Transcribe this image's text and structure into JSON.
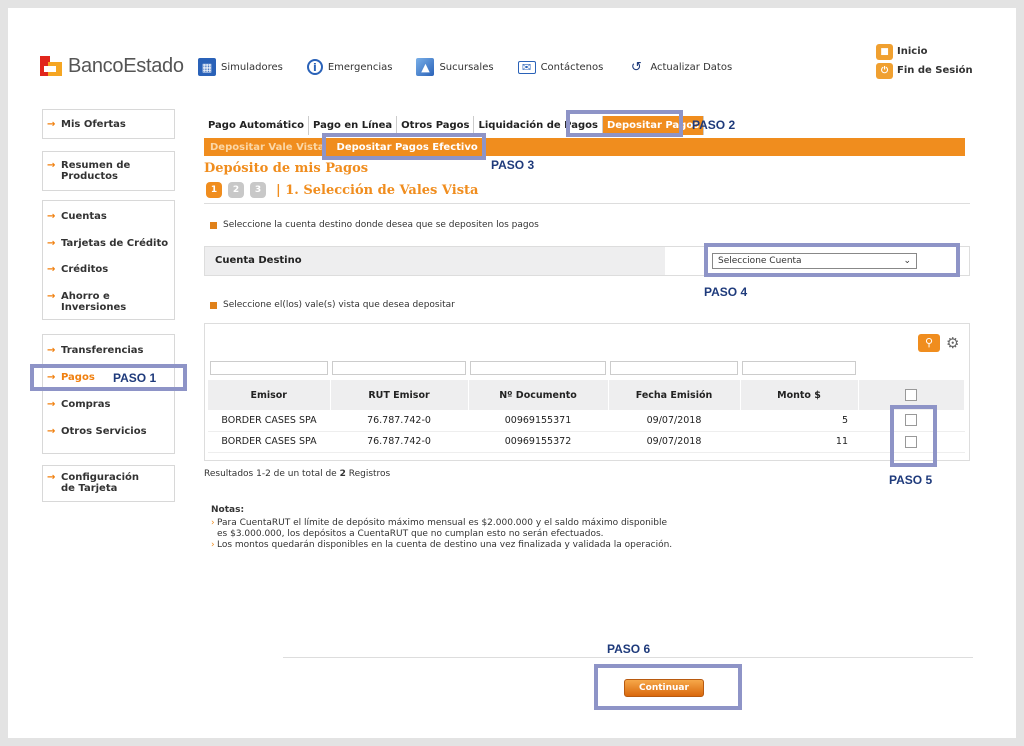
{
  "header": {
    "brand": "BancoEstado",
    "nav": [
      {
        "label": "Simuladores",
        "icon": "calculator-icon"
      },
      {
        "label": "Emergencias",
        "icon": "info-icon"
      },
      {
        "label": "Sucursales",
        "icon": "map-icon"
      },
      {
        "label": "Contáctenos",
        "icon": "envelope-icon"
      },
      {
        "label": "Actualizar Datos",
        "icon": "refresh-icon"
      }
    ],
    "inicio": "Inicio",
    "fin_sesion": "Fin de Sesión"
  },
  "sidebar": {
    "mis_ofertas": "Mis Ofertas",
    "resumen": "Resumen de Productos",
    "cuentas": "Cuentas",
    "tarjetas": "Tarjetas de Crédito",
    "creditos": "Créditos",
    "ahorro": "Ahorro e Inversiones",
    "transferencias": "Transferencias",
    "pagos": "Pagos",
    "compras": "Compras",
    "otros": "Otros Servicios",
    "config": "Configuración de Tarjeta"
  },
  "tabs": [
    "Pago Automático",
    "Pago en Línea",
    "Otros Pagos",
    "Liquidación de Pagos",
    "Depositar Pagos"
  ],
  "subtabs": [
    "Depositar Vale Vista",
    "Depositar Pagos Efectivo  |"
  ],
  "page_title": "Depósito de mis Pagos",
  "steps": {
    "n1": "1",
    "n2": "2",
    "n3": "3",
    "title": "| 1. Selección de Vales Vista"
  },
  "instr1": "Seleccione la cuenta destino donde desea que se depositen los pagos",
  "cuenta_destino": {
    "label": "Cuenta Destino",
    "selected": "Seleccione Cuenta"
  },
  "instr2": "Seleccione el(los) vale(s) vista que desea depositar",
  "table": {
    "headers": [
      "Emisor",
      "RUT Emisor",
      "Nº Documento",
      "Fecha Emisión",
      "Monto $"
    ],
    "rows": [
      {
        "emisor": "BORDER CASES SPA",
        "rut": "76.787.742-0",
        "doc": "00969155371",
        "fecha": "09/07/2018",
        "monto": "5"
      },
      {
        "emisor": "BORDER CASES SPA",
        "rut": "76.787.742-0",
        "doc": "00969155372",
        "fecha": "09/07/2018",
        "monto": "11"
      }
    ]
  },
  "results": {
    "pre": "Resultados 1-2 de un total de ",
    "count": "2",
    "post": " Registros"
  },
  "notes": {
    "title": "Notas:",
    "line1": "Para CuentaRUT el límite de depósito máximo mensual es $2.000.000 y el saldo máximo disponible",
    "line1b": "es $3.000.000, los depósitos a CuentaRUT que no cumplan esto no serán efectuados.",
    "line2": "Los montos quedarán disponibles en la cuenta de destino una vez finalizada y validada la operación."
  },
  "button": "Continuar",
  "pasos": [
    "PASO 1",
    "PASO 2",
    "PASO 3",
    "PASO 4",
    "PASO 5",
    "PASO 6"
  ],
  "colors": {
    "accent": "#f08d1e",
    "highlight": "#8e94c7",
    "paso": "#1e3a7b"
  }
}
